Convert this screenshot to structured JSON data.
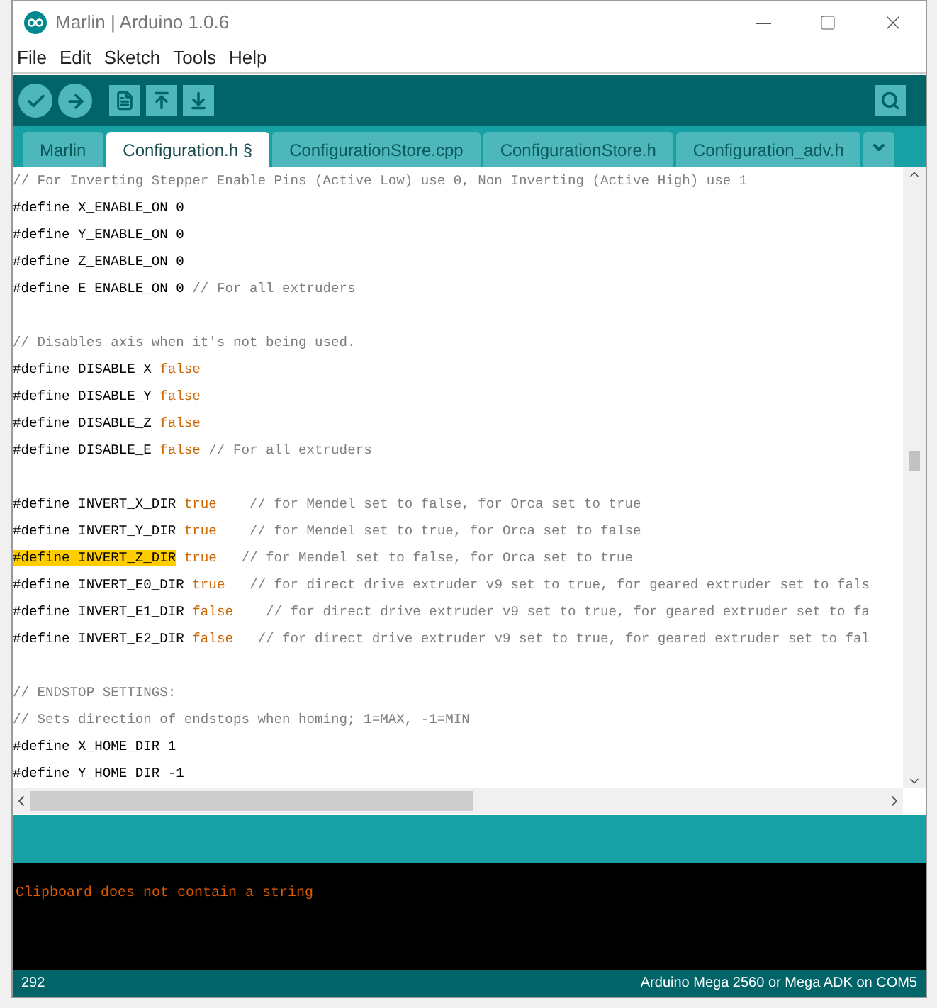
{
  "window": {
    "title": "Marlin | Arduino 1.0.6"
  },
  "menu": [
    "File",
    "Edit",
    "Sketch",
    "Tools",
    "Help"
  ],
  "toolbar": [
    {
      "kind": "verify"
    },
    {
      "kind": "upload"
    },
    {
      "kind": "new"
    },
    {
      "kind": "open"
    },
    {
      "kind": "save"
    }
  ],
  "tabs": [
    {
      "label": "Marlin",
      "selected": false
    },
    {
      "label": "Configuration.h §",
      "selected": true
    },
    {
      "label": "ConfigurationStore.cpp",
      "selected": false
    },
    {
      "label": "ConfigurationStore.h",
      "selected": false
    },
    {
      "label": "Configuration_adv.h",
      "selected": false
    }
  ],
  "editor": {
    "lines": [
      {
        "kind": "code",
        "segments": [
          {
            "kind": "comment",
            "text": "// For Inverting Stepper Enable Pins (Active Low) use 0, Non Inverting (Active High) use 1"
          }
        ]
      },
      {
        "kind": "code",
        "segments": [
          {
            "kind": "code",
            "text": "#define X_ENABLE_ON 0"
          }
        ]
      },
      {
        "kind": "code",
        "segments": [
          {
            "kind": "code",
            "text": "#define Y_ENABLE_ON 0"
          }
        ]
      },
      {
        "kind": "code",
        "segments": [
          {
            "kind": "code",
            "text": "#define Z_ENABLE_ON 0"
          }
        ]
      },
      {
        "kind": "code",
        "segments": [
          {
            "kind": "code",
            "text": "#define E_ENABLE_ON 0 "
          },
          {
            "kind": "comment",
            "text": "// For all extruders"
          }
        ]
      },
      {
        "kind": "blank"
      },
      {
        "kind": "code",
        "segments": [
          {
            "kind": "comment",
            "text": "// Disables axis when it's not being used."
          }
        ]
      },
      {
        "kind": "code",
        "segments": [
          {
            "kind": "code",
            "text": "#define DISABLE_X "
          },
          {
            "kind": "value",
            "text": "false"
          }
        ]
      },
      {
        "kind": "code",
        "segments": [
          {
            "kind": "code",
            "text": "#define DISABLE_Y "
          },
          {
            "kind": "value",
            "text": "false"
          }
        ]
      },
      {
        "kind": "code",
        "segments": [
          {
            "kind": "code",
            "text": "#define DISABLE_Z "
          },
          {
            "kind": "value",
            "text": "false"
          }
        ]
      },
      {
        "kind": "code",
        "segments": [
          {
            "kind": "code",
            "text": "#define DISABLE_E "
          },
          {
            "kind": "value",
            "text": "false"
          },
          {
            "kind": "comment",
            "text": " // For all extruders"
          }
        ]
      },
      {
        "kind": "blank"
      },
      {
        "kind": "code",
        "segments": [
          {
            "kind": "code",
            "text": "#define INVERT_X_DIR "
          },
          {
            "kind": "value",
            "text": "true"
          },
          {
            "kind": "comment",
            "text": "    // for Mendel set to false, for Orca set to true"
          }
        ]
      },
      {
        "kind": "code",
        "segments": [
          {
            "kind": "code",
            "text": "#define INVERT_Y_DIR "
          },
          {
            "kind": "value",
            "text": "true"
          },
          {
            "kind": "comment",
            "text": "    // for Mendel set to true, for Orca set to false"
          }
        ]
      },
      {
        "kind": "code",
        "segments": [
          {
            "kind": "highlight",
            "text": "#define INVERT_Z_DIR"
          },
          {
            "kind": "value",
            "text": " true"
          },
          {
            "kind": "comment",
            "text": "   // for Mendel set to false, for Orca set to true"
          }
        ]
      },
      {
        "kind": "code",
        "segments": [
          {
            "kind": "code",
            "text": "#define INVERT_E0_DIR "
          },
          {
            "kind": "value",
            "text": "true"
          },
          {
            "kind": "comment",
            "text": "   // for direct drive extruder v9 set to true, for geared extruder set to fals"
          }
        ]
      },
      {
        "kind": "code",
        "segments": [
          {
            "kind": "code",
            "text": "#define INVERT_E1_DIR "
          },
          {
            "kind": "value",
            "text": "false"
          },
          {
            "kind": "comment",
            "text": "    // for direct drive extruder v9 set to true, for geared extruder set to fa"
          }
        ]
      },
      {
        "kind": "code",
        "segments": [
          {
            "kind": "code",
            "text": "#define INVERT_E2_DIR "
          },
          {
            "kind": "value",
            "text": "false"
          },
          {
            "kind": "comment",
            "text": "   // for direct drive extruder v9 set to true, for geared extruder set to fal"
          }
        ]
      },
      {
        "kind": "blank"
      },
      {
        "kind": "code",
        "segments": [
          {
            "kind": "comment",
            "text": "// ENDSTOP SETTINGS:"
          }
        ]
      },
      {
        "kind": "code",
        "segments": [
          {
            "kind": "comment",
            "text": "// Sets direction of endstops when homing; 1=MAX, -1=MIN"
          }
        ]
      },
      {
        "kind": "code",
        "segments": [
          {
            "kind": "code",
            "text": "#define X_HOME_DIR 1"
          }
        ]
      },
      {
        "kind": "code",
        "segments": [
          {
            "kind": "code",
            "text": "#define Y_HOME_DIR -1"
          }
        ]
      }
    ]
  },
  "console": {
    "message": "Clipboard does not contain a string"
  },
  "status_bar": {
    "line": "292",
    "board": "Arduino Mega 2560 or Mega ADK on COM5"
  }
}
